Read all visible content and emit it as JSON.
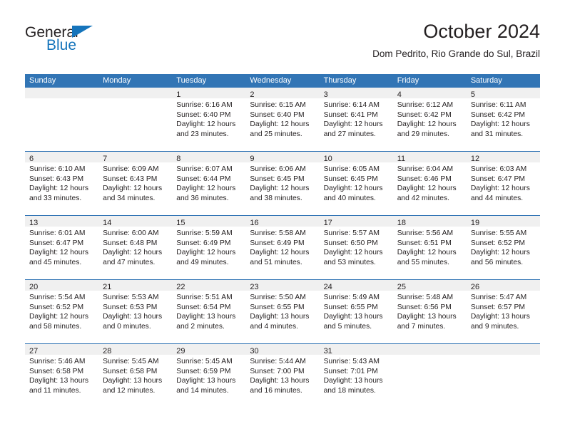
{
  "brand": {
    "name_dark": "General",
    "name_blue": "Blue",
    "accent_color": "#1574bb"
  },
  "header": {
    "title": "October 2024",
    "location": "Dom Pedrito, Rio Grande do Sul, Brazil"
  },
  "calendar": {
    "header_bg": "#3275b5",
    "daynum_bg": "#f0f0f0",
    "weekdays": [
      "Sunday",
      "Monday",
      "Tuesday",
      "Wednesday",
      "Thursday",
      "Friday",
      "Saturday"
    ],
    "weeks": [
      [
        {
          "day": "",
          "lines": []
        },
        {
          "day": "",
          "lines": []
        },
        {
          "day": "1",
          "lines": [
            "Sunrise: 6:16 AM",
            "Sunset: 6:40 PM",
            "Daylight: 12 hours",
            "and 23 minutes."
          ]
        },
        {
          "day": "2",
          "lines": [
            "Sunrise: 6:15 AM",
            "Sunset: 6:40 PM",
            "Daylight: 12 hours",
            "and 25 minutes."
          ]
        },
        {
          "day": "3",
          "lines": [
            "Sunrise: 6:14 AM",
            "Sunset: 6:41 PM",
            "Daylight: 12 hours",
            "and 27 minutes."
          ]
        },
        {
          "day": "4",
          "lines": [
            "Sunrise: 6:12 AM",
            "Sunset: 6:42 PM",
            "Daylight: 12 hours",
            "and 29 minutes."
          ]
        },
        {
          "day": "5",
          "lines": [
            "Sunrise: 6:11 AM",
            "Sunset: 6:42 PM",
            "Daylight: 12 hours",
            "and 31 minutes."
          ]
        }
      ],
      [
        {
          "day": "6",
          "lines": [
            "Sunrise: 6:10 AM",
            "Sunset: 6:43 PM",
            "Daylight: 12 hours",
            "and 33 minutes."
          ]
        },
        {
          "day": "7",
          "lines": [
            "Sunrise: 6:09 AM",
            "Sunset: 6:43 PM",
            "Daylight: 12 hours",
            "and 34 minutes."
          ]
        },
        {
          "day": "8",
          "lines": [
            "Sunrise: 6:07 AM",
            "Sunset: 6:44 PM",
            "Daylight: 12 hours",
            "and 36 minutes."
          ]
        },
        {
          "day": "9",
          "lines": [
            "Sunrise: 6:06 AM",
            "Sunset: 6:45 PM",
            "Daylight: 12 hours",
            "and 38 minutes."
          ]
        },
        {
          "day": "10",
          "lines": [
            "Sunrise: 6:05 AM",
            "Sunset: 6:45 PM",
            "Daylight: 12 hours",
            "and 40 minutes."
          ]
        },
        {
          "day": "11",
          "lines": [
            "Sunrise: 6:04 AM",
            "Sunset: 6:46 PM",
            "Daylight: 12 hours",
            "and 42 minutes."
          ]
        },
        {
          "day": "12",
          "lines": [
            "Sunrise: 6:03 AM",
            "Sunset: 6:47 PM",
            "Daylight: 12 hours",
            "and 44 minutes."
          ]
        }
      ],
      [
        {
          "day": "13",
          "lines": [
            "Sunrise: 6:01 AM",
            "Sunset: 6:47 PM",
            "Daylight: 12 hours",
            "and 45 minutes."
          ]
        },
        {
          "day": "14",
          "lines": [
            "Sunrise: 6:00 AM",
            "Sunset: 6:48 PM",
            "Daylight: 12 hours",
            "and 47 minutes."
          ]
        },
        {
          "day": "15",
          "lines": [
            "Sunrise: 5:59 AM",
            "Sunset: 6:49 PM",
            "Daylight: 12 hours",
            "and 49 minutes."
          ]
        },
        {
          "day": "16",
          "lines": [
            "Sunrise: 5:58 AM",
            "Sunset: 6:49 PM",
            "Daylight: 12 hours",
            "and 51 minutes."
          ]
        },
        {
          "day": "17",
          "lines": [
            "Sunrise: 5:57 AM",
            "Sunset: 6:50 PM",
            "Daylight: 12 hours",
            "and 53 minutes."
          ]
        },
        {
          "day": "18",
          "lines": [
            "Sunrise: 5:56 AM",
            "Sunset: 6:51 PM",
            "Daylight: 12 hours",
            "and 55 minutes."
          ]
        },
        {
          "day": "19",
          "lines": [
            "Sunrise: 5:55 AM",
            "Sunset: 6:52 PM",
            "Daylight: 12 hours",
            "and 56 minutes."
          ]
        }
      ],
      [
        {
          "day": "20",
          "lines": [
            "Sunrise: 5:54 AM",
            "Sunset: 6:52 PM",
            "Daylight: 12 hours",
            "and 58 minutes."
          ]
        },
        {
          "day": "21",
          "lines": [
            "Sunrise: 5:53 AM",
            "Sunset: 6:53 PM",
            "Daylight: 13 hours",
            "and 0 minutes."
          ]
        },
        {
          "day": "22",
          "lines": [
            "Sunrise: 5:51 AM",
            "Sunset: 6:54 PM",
            "Daylight: 13 hours",
            "and 2 minutes."
          ]
        },
        {
          "day": "23",
          "lines": [
            "Sunrise: 5:50 AM",
            "Sunset: 6:55 PM",
            "Daylight: 13 hours",
            "and 4 minutes."
          ]
        },
        {
          "day": "24",
          "lines": [
            "Sunrise: 5:49 AM",
            "Sunset: 6:55 PM",
            "Daylight: 13 hours",
            "and 5 minutes."
          ]
        },
        {
          "day": "25",
          "lines": [
            "Sunrise: 5:48 AM",
            "Sunset: 6:56 PM",
            "Daylight: 13 hours",
            "and 7 minutes."
          ]
        },
        {
          "day": "26",
          "lines": [
            "Sunrise: 5:47 AM",
            "Sunset: 6:57 PM",
            "Daylight: 13 hours",
            "and 9 minutes."
          ]
        }
      ],
      [
        {
          "day": "27",
          "lines": [
            "Sunrise: 5:46 AM",
            "Sunset: 6:58 PM",
            "Daylight: 13 hours",
            "and 11 minutes."
          ]
        },
        {
          "day": "28",
          "lines": [
            "Sunrise: 5:45 AM",
            "Sunset: 6:58 PM",
            "Daylight: 13 hours",
            "and 12 minutes."
          ]
        },
        {
          "day": "29",
          "lines": [
            "Sunrise: 5:45 AM",
            "Sunset: 6:59 PM",
            "Daylight: 13 hours",
            "and 14 minutes."
          ]
        },
        {
          "day": "30",
          "lines": [
            "Sunrise: 5:44 AM",
            "Sunset: 7:00 PM",
            "Daylight: 13 hours",
            "and 16 minutes."
          ]
        },
        {
          "day": "31",
          "lines": [
            "Sunrise: 5:43 AM",
            "Sunset: 7:01 PM",
            "Daylight: 13 hours",
            "and 18 minutes."
          ]
        },
        {
          "day": "",
          "lines": []
        },
        {
          "day": "",
          "lines": []
        }
      ]
    ]
  }
}
